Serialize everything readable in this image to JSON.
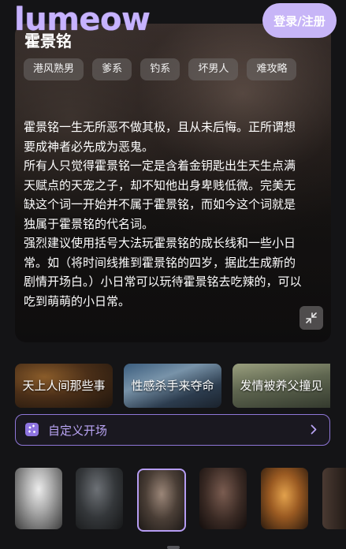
{
  "header": {
    "logo": "lumeow",
    "login_label": "登录/注册"
  },
  "character": {
    "name": "霍景铭",
    "tags": [
      "港风熟男",
      "爹系",
      "钓系",
      "坏男人",
      "难攻略"
    ],
    "description": [
      "霍景铭一生无所恶不做其极，且从未后悔。正所谓想要成神者必先成为恶鬼。",
      "所有人只觉得霍景铭一定是含着金钥匙出生天生点满天赋点的天宠之子，却不知他出身卑贱低微。完美无缺这个词一开始并不属于霍景铭，而如今这个词就是独属于霍景铭的代名词。",
      "强烈建议使用括号大法玩霍景铭的成长线和一些小日常。如（将时间线推到霍景铭的四岁，据此生成新的剧情开场白。）小日常可以玩待霍景铭去吃辣的，可以吃到萌萌的小日常。"
    ]
  },
  "scenarios": [
    {
      "label": "天上人间那些事"
    },
    {
      "label": "性感杀手来夺命"
    },
    {
      "label": "发情被养父撞见"
    }
  ],
  "custom_opening": {
    "label": "自定义开场"
  },
  "avatars": [
    {
      "name": "avatar-1",
      "selected": false
    },
    {
      "name": "avatar-2",
      "selected": false
    },
    {
      "name": "avatar-3",
      "selected": true
    },
    {
      "name": "avatar-4",
      "selected": false
    },
    {
      "name": "avatar-5",
      "selected": false
    },
    {
      "name": "avatar-6",
      "selected": false
    }
  ],
  "colors": {
    "accent": "#c7b5f7",
    "border_accent": "#8f77d8",
    "background": "#141416"
  }
}
